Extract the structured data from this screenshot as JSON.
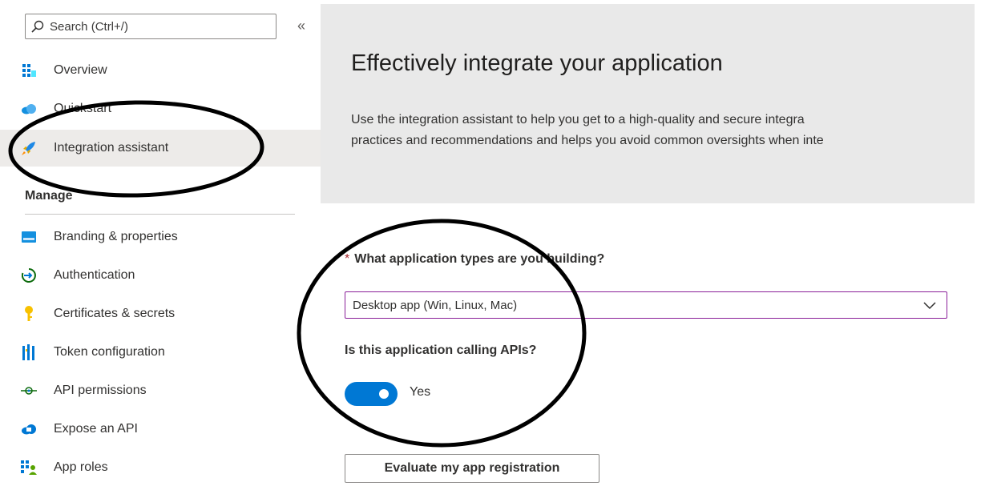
{
  "sidebar": {
    "search_placeholder": "Search (Ctrl+/)",
    "collapse_glyph": "«",
    "top_items": [
      {
        "label": "Overview",
        "icon": "overview-grid-icon"
      },
      {
        "label": "Quickstart",
        "icon": "quickstart-cloud-icon"
      },
      {
        "label": "Integration assistant",
        "icon": "rocket-icon"
      }
    ],
    "section_title": "Manage",
    "manage_items": [
      {
        "label": "Branding & properties",
        "icon": "branding-card-icon"
      },
      {
        "label": "Authentication",
        "icon": "authentication-arrow-icon"
      },
      {
        "label": "Certificates & secrets",
        "icon": "key-icon"
      },
      {
        "label": "Token configuration",
        "icon": "token-bars-icon"
      },
      {
        "label": "API permissions",
        "icon": "api-permissions-icon"
      },
      {
        "label": "Expose an API",
        "icon": "cloud-api-icon"
      },
      {
        "label": "App roles",
        "icon": "app-roles-icon"
      }
    ],
    "active_item": "Integration assistant"
  },
  "main": {
    "hero": {
      "title": "Effectively integrate your application",
      "desc_line1": "Use the integration assistant to help you get to a high-quality and secure integra",
      "desc_line2": "practices and recommendations and helps you avoid common oversights when inte"
    },
    "question1": {
      "required_marker": "*",
      "label": "What application types are you building?"
    },
    "app_type_select": {
      "value": "Desktop app (Win, Linux, Mac)"
    },
    "question2": {
      "label": "Is this application calling APIs?"
    },
    "calling_apis_toggle": {
      "on": true,
      "label": "Yes"
    },
    "evaluate_button": {
      "label": "Evaluate my app registration"
    }
  },
  "colors": {
    "accent": "#0078d4",
    "select_border": "#8a1f99",
    "required": "#a4262c",
    "hero_bg": "#e9e9e9"
  }
}
